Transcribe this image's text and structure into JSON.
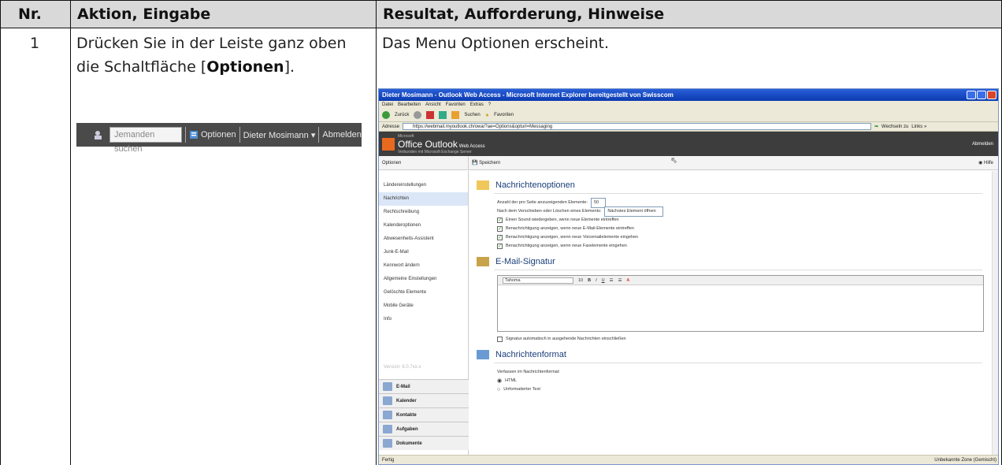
{
  "header": {
    "nr": "Nr.",
    "aktion": "Aktion, Eingabe",
    "resultat": "Resultat, Aufforderung, Hinweise"
  },
  "row": {
    "number": "1",
    "action_prefix": "Drücken Sie in der Leiste ganz oben die Schaltfläche [",
    "action_bold": "Optionen",
    "action_suffix": "].",
    "result": "Das Menu Optionen erscheint."
  },
  "searchbar": {
    "placeholder": "Jemanden suchen",
    "options": "Optionen",
    "user": "Dieter Mosimann ▾",
    "logout": "Abmelden"
  },
  "browser": {
    "title": "Dieter Mosimann - Outlook Web Access - Microsoft Internet Explorer bereitgestellt von Swisscom",
    "menu": [
      "Datei",
      "Bearbeiten",
      "Ansicht",
      "Favoriten",
      "Extras",
      "?"
    ],
    "toolbar_back": "Zurück",
    "toolbar_search": "Suchen",
    "toolbar_fav": "Favoriten",
    "address_label": "Adresse",
    "url": "https://webmail.myoutlook.ch/owa/?ae=Options&opturl=Messaging",
    "go": "Wechseln zu",
    "links": "Links »",
    "status": "Fertig",
    "zone": "Unbekannte Zone (Gemischt)"
  },
  "owa": {
    "brand_small": "Microsoft",
    "brand": "Office Outlook",
    "brand_suffix": "Web Access",
    "sub": "Verbunden mit Microsoft Exchange Server",
    "logout": "Abmelden",
    "options_label": "Optionen",
    "save": "Speichern",
    "help": "Hilfe",
    "nav": [
      "Ländereinstellungen",
      "Nachrichten",
      "Rechtschreibung",
      "Kalenderoptionen",
      "Abwesenheits-Assistent",
      "Junk-E-Mail",
      "Kennwort ändern",
      "Allgemeine Einstellungen",
      "Gelöschte Elemente",
      "Mobile Geräte",
      "Info"
    ],
    "version": "Version: 8.0.7xx.x",
    "modules": [
      "E-Mail",
      "Kalender",
      "Kontakte",
      "Aufgaben",
      "Dokumente"
    ],
    "sec1": "Nachrichtenoptionen",
    "items_label": "Anzahl der pro Seite anzuzeigenden Elemente:",
    "items_value": "50",
    "after_move_label": "Nach dem Verschieben oder Löschen eines Elements:",
    "after_move_value": "Nächstes Element öffnen",
    "checks": [
      "Einen Sound wiedergeben, wenn neue Elemente eintreffen",
      "Benachrichtigung anzeigen, wenn neue E-Mail-Elemente eintreffen",
      "Benachrichtigung anzeigen, wenn neue Voicemailelemente eingehen",
      "Benachrichtigung anzeigen, wenn neue Faxelemente eingehen"
    ],
    "sec2": "E-Mail-Signatur",
    "font": "Tahoma",
    "size": "10",
    "sig_check": "Signatur automatisch in ausgehende Nachrichten einschließen",
    "sec3": "Nachrichtenformat",
    "compose_label": "Verfassen im Nachrichtenformat:",
    "fmt_html": "HTML",
    "fmt_text": "Unformatierter Text"
  }
}
